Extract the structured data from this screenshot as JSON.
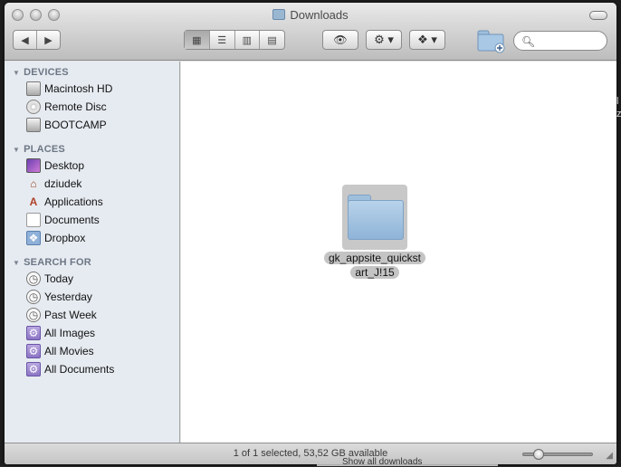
{
  "window": {
    "title": "Downloads"
  },
  "background": {
    "right_text": "l\nz",
    "bottom_text": "Show all downloads"
  },
  "toolbar": {
    "back_glyph": "◀",
    "forward_glyph": "▶",
    "view_icons": [
      "icon-view-icon",
      "list-view-icon",
      "column-view-icon",
      "coverflow-view-icon"
    ],
    "view_glyphs": [
      "▦",
      "☰",
      "▥",
      "▤"
    ],
    "quicklook_glyph": "👁",
    "action_glyph": "⚙ ▾",
    "dropbox_glyph": "❖ ▾",
    "search_placeholder": ""
  },
  "sidebar": {
    "devices_label": "DEVICES",
    "devices": [
      {
        "label": "Macintosh HD",
        "icon": "hard-disk-icon"
      },
      {
        "label": "Remote Disc",
        "icon": "disc-icon"
      },
      {
        "label": "BOOTCAMP",
        "icon": "hard-disk-icon"
      }
    ],
    "places_label": "PLACES",
    "places": [
      {
        "label": "Desktop",
        "icon": "desktop-icon"
      },
      {
        "label": "dziudek",
        "icon": "home-icon"
      },
      {
        "label": "Applications",
        "icon": "applications-icon"
      },
      {
        "label": "Documents",
        "icon": "documents-icon"
      },
      {
        "label": "Dropbox",
        "icon": "dropbox-icon"
      }
    ],
    "search_label": "SEARCH FOR",
    "search_for": [
      {
        "label": "Today",
        "icon": "clock-icon"
      },
      {
        "label": "Yesterday",
        "icon": "clock-icon"
      },
      {
        "label": "Past Week",
        "icon": "clock-icon"
      },
      {
        "label": "All Images",
        "icon": "smart-folder-icon"
      },
      {
        "label": "All Movies",
        "icon": "smart-folder-icon"
      },
      {
        "label": "All Documents",
        "icon": "smart-folder-icon"
      }
    ]
  },
  "content": {
    "folder_name_line1": "gk_appsite_quickst",
    "folder_name_line2": "art_J!15"
  },
  "status": {
    "text": "1 of 1 selected, 53,52 GB available"
  }
}
